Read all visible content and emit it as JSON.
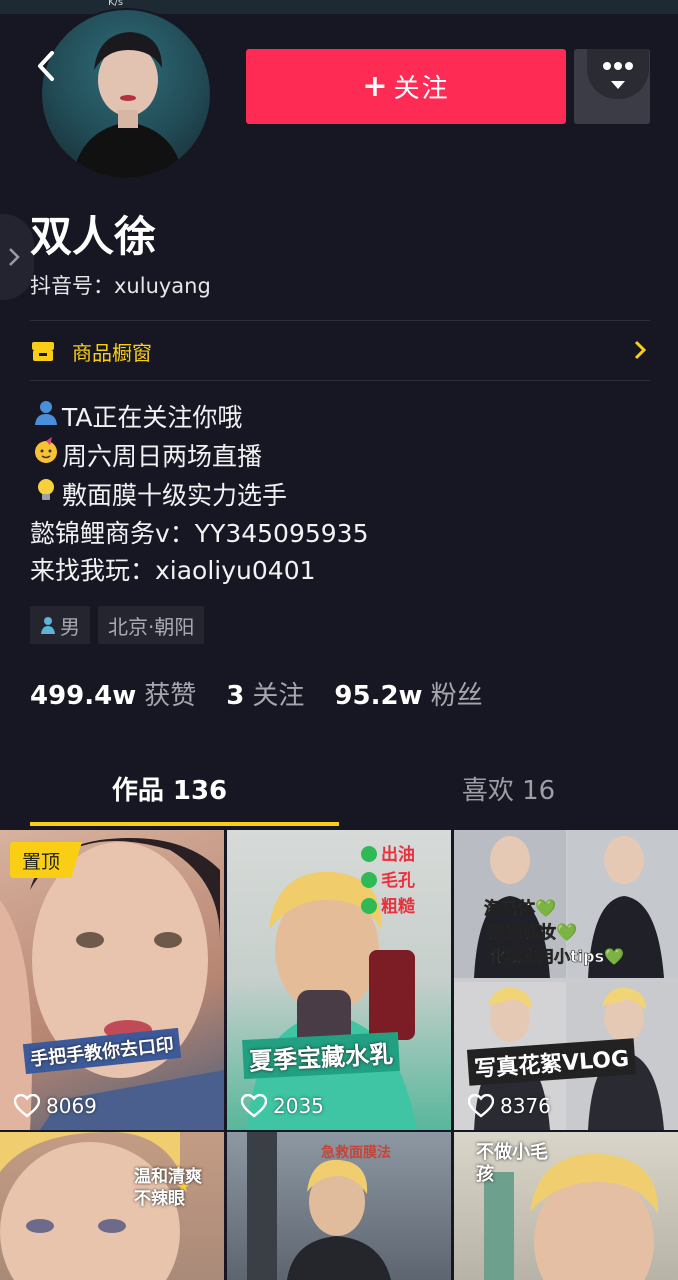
{
  "status": {
    "speed": "K/s"
  },
  "profile": {
    "nickname": "双人徐",
    "douyin_id": "抖音号：xuluyang",
    "follow_label": "关注",
    "shop_label": "商品橱窗",
    "bio": [
      {
        "emoji": "person-silhouette",
        "text": "TA正在关注你哦"
      },
      {
        "emoji": "party-face",
        "text": "周六周日两场直播"
      },
      {
        "emoji": "light-bulb",
        "text": "敷面膜十级实力选手"
      },
      {
        "emoji": "",
        "text": "懿锦鲤商务v：YY345095935"
      },
      {
        "emoji": "",
        "text": "来找我玩：xiaoliyu0401"
      }
    ],
    "tags": {
      "gender": "男",
      "location": "北京·朝阳"
    },
    "stats": [
      {
        "num": "499.4w",
        "label": "获赞"
      },
      {
        "num": "3",
        "label": "关注"
      },
      {
        "num": "95.2w",
        "label": "粉丝"
      }
    ]
  },
  "tabs": {
    "works": "作品 136",
    "likes": "喜欢 16"
  },
  "videos": [
    {
      "likes": "8069",
      "pinned": "置顶",
      "caption": "手把手教你去口印",
      "bg": "#c99a85"
    },
    {
      "likes": "2035",
      "pinned": "",
      "caption": "夏季宝藏水乳",
      "bg": "#4fa88f"
    },
    {
      "likes": "8376",
      "pinned": "",
      "caption": "写真花絮VLOG",
      "bg": "#9a9aa0"
    },
    {
      "likes": "",
      "pinned": "",
      "caption": "温和清爽不辣眼",
      "bg": "#b79a7d"
    },
    {
      "likes": "",
      "pinned": "",
      "caption": "急救面膜法",
      "bg": "#7d8790"
    },
    {
      "likes": "",
      "pinned": "",
      "caption": "不做小毛孩",
      "bg": "#a3a7a2"
    }
  ],
  "colors": {
    "accent": "#fe2c55",
    "gold": "#face15",
    "bg": "#161722"
  }
}
